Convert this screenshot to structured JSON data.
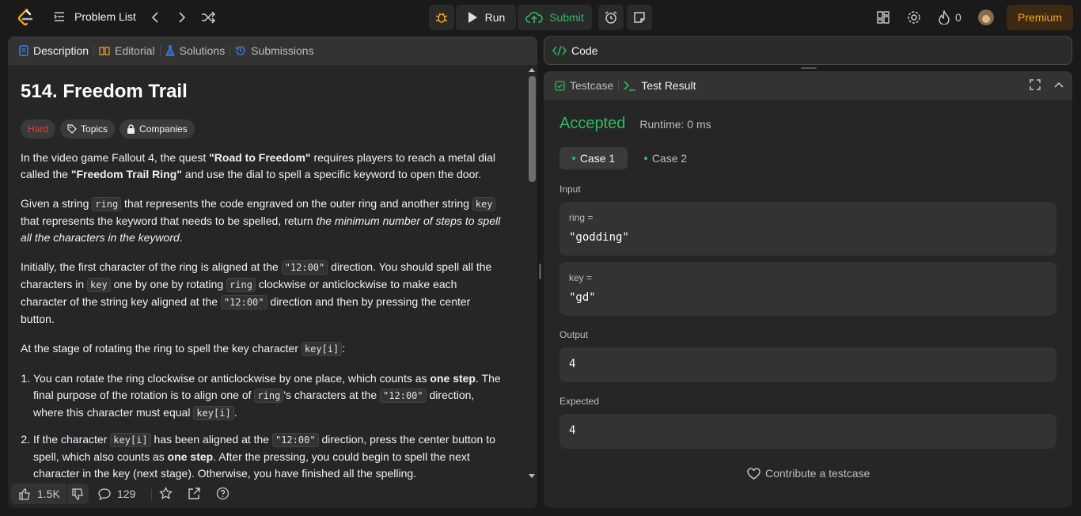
{
  "header": {
    "problem_list": "Problem List",
    "run": "Run",
    "submit": "Submit",
    "streak": "0",
    "premium": "Premium"
  },
  "left": {
    "tabs": [
      "Description",
      "Editorial",
      "Solutions",
      "Submissions"
    ],
    "title": "514. Freedom Trail",
    "tags": {
      "difficulty": "Hard",
      "topics": "Topics",
      "companies": "Companies"
    },
    "p1": {
      "t1": "In the video game Fallout 4, the quest ",
      "b1": "\"Road to Freedom\"",
      "t2": " requires players to reach a metal dial called the ",
      "b2": "\"Freedom Trail Ring\"",
      "t3": " and use the dial to spell a specific keyword to open the door."
    },
    "p2": {
      "t1": "Given a string ",
      "c1": "ring",
      "t2": " that represents the code engraved on the outer ring and another string ",
      "c2": "key",
      "t3": " that represents the keyword that needs to be spelled, return ",
      "i1": "the minimum number of steps to spell all the characters in the keyword",
      "t4": "."
    },
    "p3": {
      "t1": "Initially, the first character of the ring is aligned at the ",
      "c1": "\"12:00\"",
      "t2": " direction. You should spell all the characters in ",
      "c2": "key",
      "t3": " one by one by rotating ",
      "c3": "ring",
      "t4": " clockwise or anticlockwise to make each character of the string key aligned at the ",
      "c4": "\"12:00\"",
      "t5": " direction and then by pressing the center button."
    },
    "p4": {
      "t1": "At the stage of rotating the ring to spell the key character ",
      "c1": "key[i]",
      "t2": ":"
    },
    "li1": {
      "t1": "You can rotate the ring clockwise or anticlockwise by one place, which counts as ",
      "b1": "one step",
      "t2": ". The final purpose of the rotation is to align one of ",
      "c1": "ring",
      "t3": "'s characters at the ",
      "c2": "\"12:00\"",
      "t4": " direction, where this character must equal ",
      "c3": "key[i]",
      "t5": "."
    },
    "li2": {
      "t1": "If the character ",
      "c1": "key[i]",
      "t2": " has been aligned at the ",
      "c2": "\"12:00\"",
      "t3": " direction, press the center button to spell, which also counts as ",
      "b1": "one step",
      "t4": ". After the pressing, you could begin to spell the next character in the key (next stage). Otherwise, you have finished all the spelling."
    },
    "likes": "1.5K",
    "comments": "129"
  },
  "code_panel": {
    "label": "Code"
  },
  "result": {
    "tabs": [
      "Testcase",
      "Test Result"
    ],
    "status": "Accepted",
    "runtime": "Runtime: 0 ms",
    "cases": [
      "Case 1",
      "Case 2"
    ],
    "input_label": "Input",
    "ring_label": "ring =",
    "ring_value": "\"godding\"",
    "key_label": "key =",
    "key_value": "\"gd\"",
    "output_label": "Output",
    "output_value": "4",
    "expected_label": "Expected",
    "expected_value": "4",
    "contribute": "Contribute a testcase"
  },
  "colors": {
    "accent_green": "#2cbb5d",
    "hard": "#f63636",
    "premium": "#ffa116"
  }
}
